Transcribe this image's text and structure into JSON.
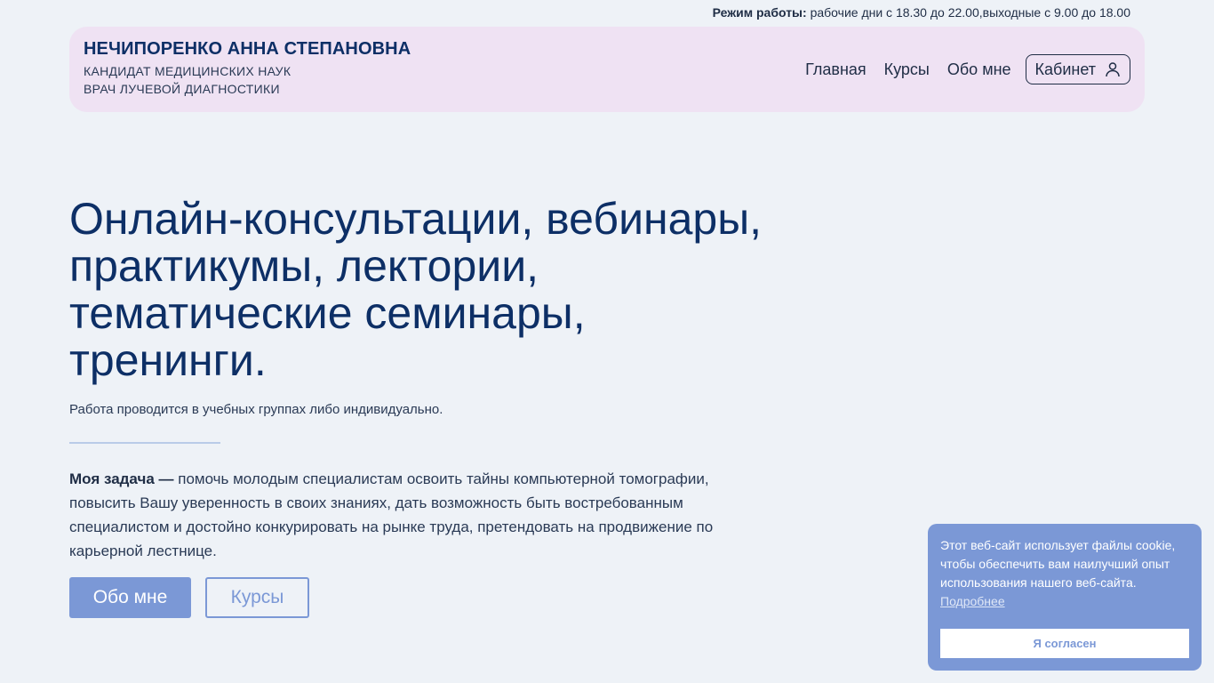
{
  "topbar": {
    "label": "Режим работы:",
    "hours": "рабочие дни с 18.30 до 22.00,выходные с 9.00 до 18.00"
  },
  "header": {
    "name": "НЕЧИПОРЕНКО АННА СТЕПАНОВНА",
    "title1": "КАНДИДАТ МЕДИЦИНСКИХ НАУК",
    "title2": "ВРАЧ ЛУЧЕВОЙ ДИАГНОСТИКИ",
    "nav": {
      "home": "Главная",
      "courses": "Курсы",
      "about": "Обо мне",
      "cabinet": "Кабинет"
    }
  },
  "hero": {
    "title": "Онлайн-консультации, вебинары, практикумы, лектории, тематические семинары, тренинги.",
    "subtitle": "Работа проводится в учебных группах либо индивидуально.",
    "task_label": "Моя задача —",
    "task_text": " помочь молодым специалистам освоить тайны компьютерной томографии, повысить Вашу уверенность в своих знаниях, дать возможность быть востребованным специалистом и достойно конкурировать на рынке труда, претендовать на продвижение по карьерной лестнице.",
    "btn_about": "Обо мне",
    "btn_courses": "Курсы"
  },
  "cookie": {
    "text": "Этот веб-сайт использует файлы cookie, чтобы обеспечить вам наилучший опыт использования нашего веб-сайта.",
    "link": "Подробнее",
    "accept": "Я согласен"
  },
  "colors": {
    "background": "#eef2f7",
    "header_bg": "#efe2f3",
    "primary": "#0d2f66",
    "accent": "#7b98d6"
  },
  "icons": {
    "cabinet": "user-icon"
  }
}
